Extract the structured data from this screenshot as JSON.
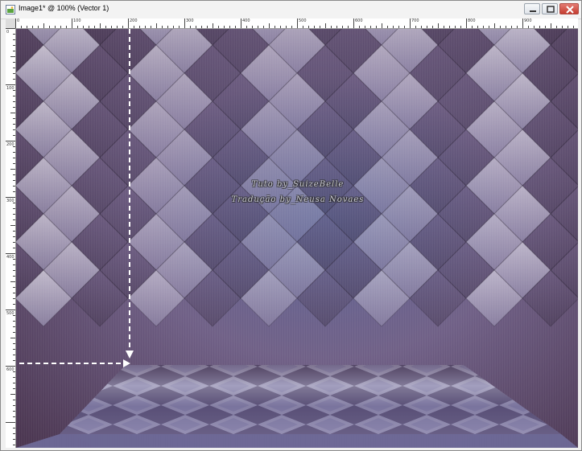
{
  "window": {
    "title": "Image1* @ 100% (Vector 1)",
    "icon": "image-icon",
    "controls": [
      "minimize-icon",
      "maximize-icon",
      "close-icon"
    ]
  },
  "ruler": {
    "top_labels": [
      "0",
      "100",
      "200",
      "300",
      "400",
      "500",
      "600",
      "700",
      "800",
      "900"
    ],
    "left_labels": [
      "0",
      "100",
      "200",
      "300",
      "400",
      "500",
      "600"
    ]
  },
  "canvas": {
    "watermark_line1": "Tuto by_SuizeBelle",
    "watermark_line2": "Tradução by_Neusa Novaes",
    "colors": {
      "purple_dark": "#3e2a45",
      "purple_mid": "#6f5d86",
      "lavender": "#c2c2d8",
      "blue_gray": "#5c6595"
    }
  }
}
